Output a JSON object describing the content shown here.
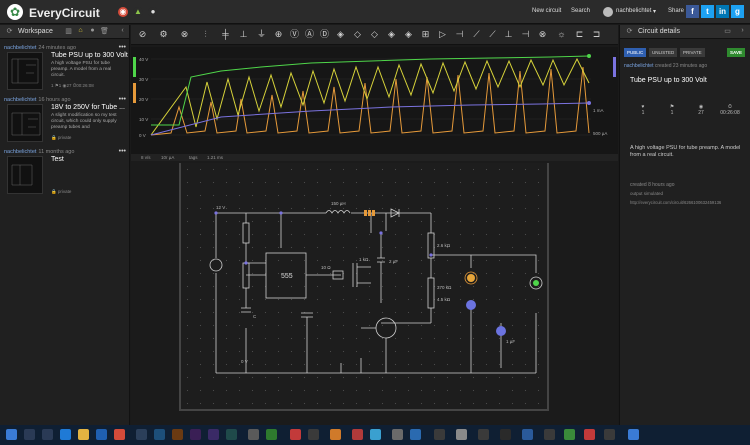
{
  "app": {
    "brand": "EveryCircuit",
    "nav": {
      "new_circuit": "New circuit",
      "search": "Search",
      "username": "nachbelichtet",
      "share": "Share"
    },
    "colors": {
      "accent": "#3a8a4a",
      "facebook": "#3b5998",
      "twitter": "#1da1f2",
      "linkedin": "#0077b5",
      "green_trace": "#4fd64a",
      "yellow_trace": "#d6d23a",
      "orange_trace": "#e69a3a",
      "blue_trace": "#7b73e0"
    }
  },
  "workspace": {
    "title": "Workspace",
    "items": [
      {
        "user": "nachbelichtet",
        "time": "24 minutes ago",
        "title": "Tube PSU up to 300 Volt",
        "desc": "A high voltage PSU for tube preamp. A model from a real circuit.",
        "meta": "1 ⚑1 ◉27 ⏱00:26:08"
      },
      {
        "user": "nachbelichtet",
        "time": "16 hours ago",
        "title": "18V to 250V for Tube ...",
        "desc": "A slight modification so my test circuit, which could only supply preamp tubes and",
        "meta": "private"
      },
      {
        "user": "nachbelichtet",
        "time": "11 months ago",
        "title": "Test",
        "desc": "",
        "meta": "private"
      }
    ]
  },
  "scope": {
    "y_labels": [
      "40 V",
      "30 V",
      "20 V",
      "10 V",
      "0 V"
    ],
    "right_labels": [
      "1 mA",
      "500 µA"
    ],
    "legend": {
      "left": "8 v/s",
      "mid": "10r µA",
      "mid2": "tags",
      "right": "1.21 ms"
    }
  },
  "circuit": {
    "labels": {
      "v12": "12 V",
      "ind": "150 µH",
      "ic": "555",
      "r10": "10 Ω",
      "r1k": "1 kΩ",
      "r2": "2.6 kΩ",
      "r3": "370 kΩ",
      "r4": "4.5 kΩ",
      "c1": "C",
      "c2": "2 µF",
      "c3": "1 µF",
      "gnd": "0 V"
    }
  },
  "details": {
    "title": "Circuit details",
    "vis": {
      "public": "PUBLIC",
      "unlisted": "UNLISTED",
      "private": "PRIVATE",
      "save": "SAVE"
    },
    "owner": "nachbelichtet",
    "created": "created 23 minutes ago",
    "name": "Tube PSU up to 300 Volt",
    "stats": [
      "1",
      "1",
      "27",
      "00:26:08"
    ],
    "description": "A high voltage PSU for tube preamp. A model from a real circuit.",
    "created2": "created 8 hours ago",
    "simulation": "output simulated",
    "url": "http://everycircuit.com/circuit/6266100632459136"
  }
}
